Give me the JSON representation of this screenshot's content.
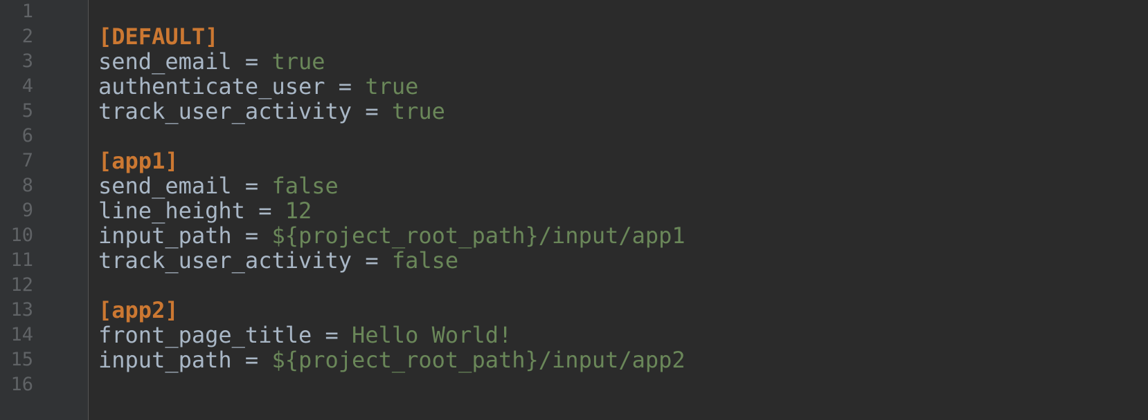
{
  "editor": {
    "lines": [
      {
        "number": "1",
        "type": "blank"
      },
      {
        "number": "2",
        "type": "section",
        "text": "[DEFAULT]"
      },
      {
        "number": "3",
        "type": "pair",
        "key": "send_email",
        "eq": " = ",
        "value": "true"
      },
      {
        "number": "4",
        "type": "pair",
        "key": "authenticate_user",
        "eq": " = ",
        "value": "true"
      },
      {
        "number": "5",
        "type": "pair",
        "key": "track_user_activity",
        "eq": " = ",
        "value": "true"
      },
      {
        "number": "6",
        "type": "blank"
      },
      {
        "number": "7",
        "type": "section",
        "text": "[app1]"
      },
      {
        "number": "8",
        "type": "pair",
        "key": "send_email",
        "eq": " = ",
        "value": "false"
      },
      {
        "number": "9",
        "type": "pair",
        "key": "line_height",
        "eq": " = ",
        "value": "12"
      },
      {
        "number": "10",
        "type": "pair",
        "key": "input_path",
        "eq": " = ",
        "value": "${project_root_path}/input/app1"
      },
      {
        "number": "11",
        "type": "pair",
        "key": "track_user_activity",
        "eq": " = ",
        "value": "false"
      },
      {
        "number": "12",
        "type": "blank"
      },
      {
        "number": "13",
        "type": "section",
        "text": "[app2]"
      },
      {
        "number": "14",
        "type": "pair",
        "key": "front_page_title",
        "eq": " = ",
        "value": "Hello World!"
      },
      {
        "number": "15",
        "type": "pair",
        "key": "input_path",
        "eq": " = ",
        "value": "${project_root_path}/input/app2"
      },
      {
        "number": "16",
        "type": "blank"
      }
    ]
  },
  "colors": {
    "background": "#2b2b2b",
    "gutter": "#313335",
    "line_number": "#606366",
    "section": "#cc7832",
    "key": "#a9b7c6",
    "value": "#6a8759"
  }
}
